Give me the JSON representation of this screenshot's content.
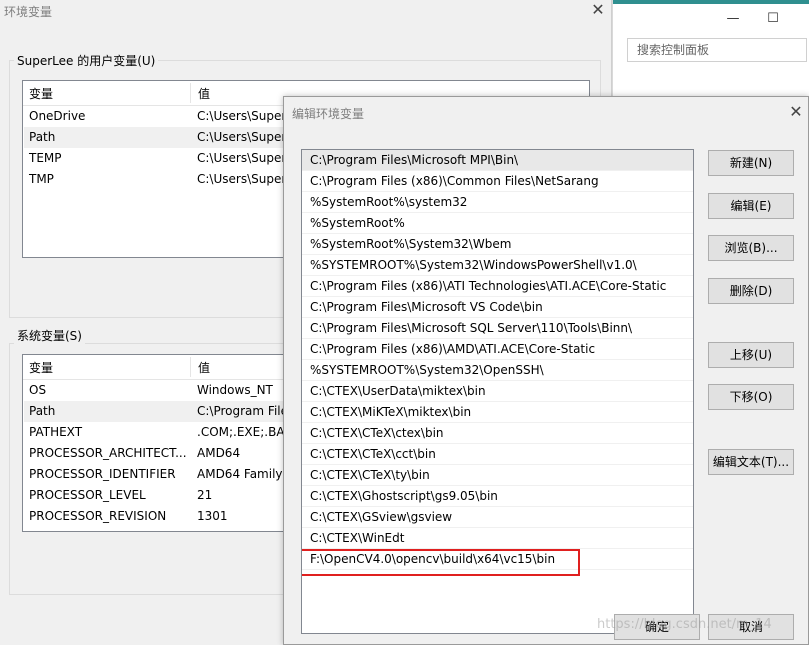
{
  "control_panel": {
    "minimize_glyph": "—",
    "maximize_glyph": "☐",
    "search_placeholder": "搜索控制面板"
  },
  "env_window": {
    "title": "环境变量",
    "close_glyph": "✕",
    "user_group_label": "SuperLee 的用户变量(U)",
    "user_headers": {
      "name": "变量",
      "value": "值"
    },
    "user_vars": [
      {
        "name": "OneDrive",
        "value": "C:\\Users\\Super"
      },
      {
        "name": "Path",
        "value": "C:\\Users\\Super"
      },
      {
        "name": "TEMP",
        "value": "C:\\Users\\Super"
      },
      {
        "name": "TMP",
        "value": "C:\\Users\\Super"
      }
    ],
    "system_group_label": "系统变量(S)",
    "system_headers": {
      "name": "变量",
      "value": "值"
    },
    "system_vars": [
      {
        "name": "OS",
        "value": "Windows_NT"
      },
      {
        "name": "Path",
        "value": "C:\\Program File"
      },
      {
        "name": "PATHEXT",
        "value": ".COM;.EXE;.BAT"
      },
      {
        "name": "PROCESSOR_ARCHITECT...",
        "value": "AMD64"
      },
      {
        "name": "PROCESSOR_IDENTIFIER",
        "value": "AMD64 Family"
      },
      {
        "name": "PROCESSOR_LEVEL",
        "value": "21"
      },
      {
        "name": "PROCESSOR_REVISION",
        "value": "1301"
      }
    ]
  },
  "edit_dialog": {
    "title": "编辑环境变量",
    "close_glyph": "✕",
    "paths": [
      "C:\\Program Files\\Microsoft MPI\\Bin\\",
      "C:\\Program Files (x86)\\Common Files\\NetSarang",
      "%SystemRoot%\\system32",
      "%SystemRoot%",
      "%SystemRoot%\\System32\\Wbem",
      "%SYSTEMROOT%\\System32\\WindowsPowerShell\\v1.0\\",
      "C:\\Program Files (x86)\\ATI Technologies\\ATI.ACE\\Core-Static",
      "C:\\Program Files\\Microsoft VS Code\\bin",
      "C:\\Program Files\\Microsoft SQL Server\\110\\Tools\\Binn\\",
      "C:\\Program Files (x86)\\AMD\\ATI.ACE\\Core-Static",
      "%SYSTEMROOT%\\System32\\OpenSSH\\",
      "C:\\CTEX\\UserData\\miktex\\bin",
      "C:\\CTEX\\MiKTeX\\miktex\\bin",
      "C:\\CTEX\\CTeX\\ctex\\bin",
      "C:\\CTEX\\CTeX\\cct\\bin",
      "C:\\CTEX\\CTeX\\ty\\bin",
      "C:\\CTEX\\Ghostscript\\gs9.05\\bin",
      "C:\\CTEX\\GSview\\gsview",
      "C:\\CTEX\\WinEdt",
      "F:\\OpenCV4.0\\opencv\\build\\x64\\vc15\\bin"
    ],
    "buttons": {
      "new": "新建(N)",
      "edit": "编辑(E)",
      "browse": "浏览(B)...",
      "delete": "删除(D)",
      "move_up": "上移(U)",
      "move_down": "下移(O)",
      "edit_text": "编辑文本(T)...",
      "ok": "确定",
      "cancel": "取消"
    }
  },
  "watermark": "https://blog.csdn.net/m_14"
}
